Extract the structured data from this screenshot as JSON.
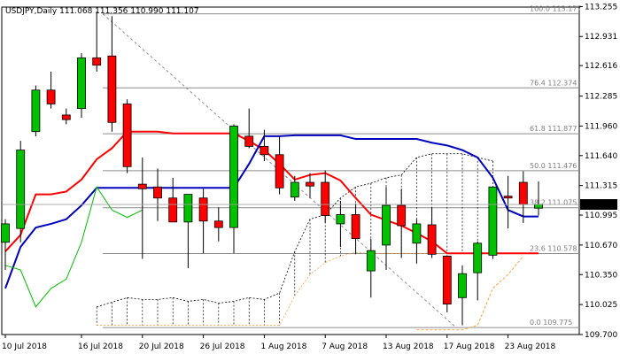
{
  "chart_data": {
    "type": "candlestick",
    "title": "USDJPY,Daily",
    "ohlc_readout": "111.068 111.356 110.990 111.107",
    "last_price_label": "111.107",
    "grid": false,
    "ylim": [
      109.7,
      113.25
    ],
    "y_ticks": [
      "113.255",
      "112.931",
      "112.616",
      "112.285",
      "111.960",
      "111.640",
      "111.315",
      "110.995",
      "110.670",
      "110.350",
      "110.025",
      "109.700"
    ],
    "x_ticks": [
      {
        "index": 0,
        "label": "10 Jul 2018"
      },
      {
        "index": 5,
        "label": "16 Jul 2018"
      },
      {
        "index": 9,
        "label": "20 Jul 2018"
      },
      {
        "index": 13,
        "label": "26 Jul 2018"
      },
      {
        "index": 17,
        "label": "1 Aug 2018"
      },
      {
        "index": 21,
        "label": "7 Aug 2018"
      },
      {
        "index": 25,
        "label": "13 Aug 2018"
      },
      {
        "index": 29,
        "label": "17 Aug 2018"
      },
      {
        "index": 33,
        "label": "23 Aug 2018"
      }
    ],
    "candles": [
      {
        "o": 110.7,
        "h": 110.95,
        "l": 110.4,
        "c": 110.9
      },
      {
        "o": 110.85,
        "h": 111.8,
        "l": 110.7,
        "c": 111.7
      },
      {
        "o": 111.9,
        "h": 112.4,
        "l": 111.85,
        "c": 112.35
      },
      {
        "o": 112.35,
        "h": 112.55,
        "l": 112.15,
        "c": 112.2
      },
      {
        "o": 112.08,
        "h": 112.15,
        "l": 111.98,
        "c": 112.03
      },
      {
        "o": 112.15,
        "h": 112.75,
        "l": 112.05,
        "c": 112.7
      },
      {
        "o": 112.7,
        "h": 113.2,
        "l": 112.55,
        "c": 112.62
      },
      {
        "o": 112.72,
        "h": 113.15,
        "l": 111.9,
        "c": 112.0
      },
      {
        "o": 112.2,
        "h": 112.25,
        "l": 111.45,
        "c": 111.52
      },
      {
        "o": 111.33,
        "h": 111.62,
        "l": 110.52,
        "c": 111.28
      },
      {
        "o": 111.3,
        "h": 111.5,
        "l": 110.93,
        "c": 111.18
      },
      {
        "o": 111.18,
        "h": 111.4,
        "l": 110.97,
        "c": 110.92
      },
      {
        "o": 110.92,
        "h": 111.2,
        "l": 110.42,
        "c": 111.22
      },
      {
        "o": 111.18,
        "h": 111.28,
        "l": 110.58,
        "c": 110.93
      },
      {
        "o": 110.93,
        "h": 111.08,
        "l": 110.71,
        "c": 110.86
      },
      {
        "o": 110.86,
        "h": 111.98,
        "l": 110.58,
        "c": 111.96
      },
      {
        "o": 111.85,
        "h": 112.15,
        "l": 111.72,
        "c": 111.74
      },
      {
        "o": 111.74,
        "h": 111.92,
        "l": 111.58,
        "c": 111.65
      },
      {
        "o": 111.65,
        "h": 111.85,
        "l": 111.22,
        "c": 111.29
      },
      {
        "o": 111.19,
        "h": 111.42,
        "l": 111.15,
        "c": 111.35
      },
      {
        "o": 111.35,
        "h": 111.45,
        "l": 111.18,
        "c": 111.31
      },
      {
        "o": 111.35,
        "h": 111.48,
        "l": 110.91,
        "c": 110.99
      },
      {
        "o": 110.9,
        "h": 111.15,
        "l": 110.65,
        "c": 111.0
      },
      {
        "o": 111.0,
        "h": 111.12,
        "l": 110.57,
        "c": 110.74
      },
      {
        "o": 110.39,
        "h": 110.74,
        "l": 110.1,
        "c": 110.61
      },
      {
        "o": 110.67,
        "h": 111.3,
        "l": 110.4,
        "c": 111.1
      },
      {
        "o": 111.1,
        "h": 111.28,
        "l": 110.53,
        "c": 110.88
      },
      {
        "o": 110.69,
        "h": 110.95,
        "l": 110.47,
        "c": 110.9
      },
      {
        "o": 110.89,
        "h": 111.08,
        "l": 110.53,
        "c": 110.57
      },
      {
        "o": 110.55,
        "h": 110.56,
        "l": 109.94,
        "c": 110.03
      },
      {
        "o": 110.1,
        "h": 110.45,
        "l": 109.8,
        "c": 110.36
      },
      {
        "o": 110.37,
        "h": 110.71,
        "l": 110.07,
        "c": 110.69
      },
      {
        "o": 110.56,
        "h": 111.3,
        "l": 110.52,
        "c": 111.3
      },
      {
        "o": 111.2,
        "h": 111.42,
        "l": 110.85,
        "c": 111.18
      },
      {
        "o": 111.35,
        "h": 111.47,
        "l": 110.91,
        "c": 111.11
      },
      {
        "o": 111.07,
        "h": 111.36,
        "l": 110.99,
        "c": 111.11
      }
    ],
    "series": [
      {
        "color": "#ff0000",
        "values": [
          110.6,
          110.78,
          111.22,
          111.22,
          111.25,
          111.38,
          111.6,
          111.72,
          111.9,
          111.9,
          111.9,
          111.88,
          111.88,
          111.88,
          111.88,
          111.88,
          111.8,
          111.7,
          111.55,
          111.38,
          111.43,
          111.45,
          111.37,
          111.18,
          111.0,
          110.94,
          110.88,
          110.8,
          110.71,
          110.58,
          110.58,
          110.58,
          110.58,
          110.58,
          110.58,
          110.58
        ]
      },
      {
        "color": "#0000bf",
        "values": [
          110.2,
          110.65,
          110.86,
          110.9,
          110.95,
          111.1,
          111.29,
          111.29,
          111.29,
          111.29,
          111.29,
          111.29,
          111.29,
          111.29,
          111.29,
          111.29,
          111.55,
          111.85,
          111.85,
          111.86,
          111.86,
          111.86,
          111.86,
          111.82,
          111.82,
          111.82,
          111.82,
          111.82,
          111.78,
          111.75,
          111.7,
          111.62,
          111.4,
          111.05,
          110.98,
          110.98
        ]
      },
      {
        "color": "#00c000",
        "values": [
          110.45,
          110.4,
          110.0,
          110.2,
          110.3,
          110.7,
          111.3,
          111.05,
          110.97,
          111.05
        ]
      },
      {
        "color": "#ffa040",
        "values": [
          109.75,
          109.75,
          109.75,
          109.75,
          109.8,
          110.2,
          110.35,
          110.55
        ]
      }
    ],
    "fib_levels": [
      {
        "label": "100.0 113.177",
        "value": 113.177
      },
      {
        "label": "76.4 112.374",
        "value": 112.374
      },
      {
        "label": "61.8 111.877",
        "value": 111.877
      },
      {
        "label": "50.0 111.476",
        "value": 111.476
      },
      {
        "label": "38.2 111.075",
        "value": 111.075
      },
      {
        "label": "23.6 110.578",
        "value": 110.578
      },
      {
        "label": "0.0 109.775",
        "value": 109.775
      }
    ],
    "cloud_upper": [
      110.0,
      110.05,
      110.1,
      110.08,
      110.08,
      110.1,
      110.06,
      110.08,
      110.04,
      110.06,
      110.1,
      110.08,
      110.15,
      110.6,
      110.95,
      111.0,
      111.18,
      111.3,
      111.34,
      111.4,
      111.43,
      111.62,
      111.66,
      111.66,
      111.66,
      111.62,
      111.58
    ],
    "cloud_lower": [
      109.8,
      109.8,
      109.8,
      109.8,
      109.8,
      109.8,
      109.8,
      109.8,
      109.8,
      109.8,
      109.8,
      109.8,
      109.8,
      110.12,
      110.35,
      110.48,
      110.55,
      110.59,
      110.58,
      110.58,
      110.58,
      110.58,
      110.58,
      110.58,
      110.58,
      110.58,
      110.58
    ]
  }
}
